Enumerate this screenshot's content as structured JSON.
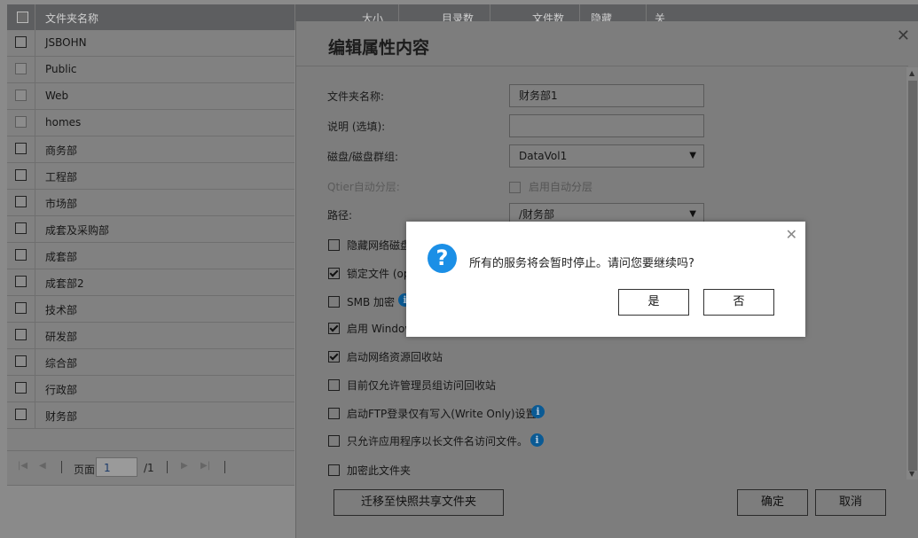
{
  "table": {
    "columns": [
      "文件夹名称",
      "大小",
      "目录数",
      "文件数",
      "隐藏",
      "关"
    ],
    "rows": [
      "JSBOHN",
      "Public",
      "Web",
      "homes",
      "商务部",
      "工程部",
      "市场部",
      "成套及采购部",
      "成套部",
      "成套部2",
      "技术部",
      "研发部",
      "综合部",
      "行政部",
      "财务部"
    ],
    "pager": {
      "page_label": "页面",
      "page_value": "1",
      "total": "/1"
    }
  },
  "dialog": {
    "title": "编辑属性内容",
    "fields": {
      "folder_name_label": "文件夹名称:",
      "folder_name_value": "财务部1",
      "desc_label": "说明 (选填):",
      "desc_value": "",
      "disk_label": "磁盘/磁盘群组:",
      "disk_value": "DataVol1",
      "qtier_label": "Qtier自动分层:",
      "qtier_option": "启用自动分层",
      "path_label": "路径:",
      "path_value": "/财务部"
    },
    "options": [
      {
        "label": "隐藏网络磁盘",
        "checked": false
      },
      {
        "label": "锁定文件 (op",
        "checked": true
      },
      {
        "label": "SMB 加密",
        "checked": false
      },
      {
        "label": "启用 Window",
        "checked": true
      },
      {
        "label": "启动网络资源回收站",
        "checked": true
      },
      {
        "label": "目前仅允许管理员组访问回收站",
        "checked": false
      },
      {
        "label": "启动FTP登录仅有写入(Write Only)设置",
        "checked": false
      },
      {
        "label": "只允许应用程序以长文件名访问文件。",
        "checked": false
      },
      {
        "label": "加密此文件夹",
        "checked": false
      }
    ],
    "buttons": {
      "migrate": "迁移至快照共享文件夹",
      "ok": "确定",
      "cancel": "取消"
    }
  },
  "confirm": {
    "message": "所有的服务将会暂时停止。请问您要继续吗?",
    "yes": "是",
    "no": "否"
  },
  "icons": {
    "close": "close-icon",
    "info": "info-icon",
    "question": "question-icon"
  },
  "colors": {
    "question_icon": "#1b8fe6",
    "info_icon": "#0a5a94"
  }
}
